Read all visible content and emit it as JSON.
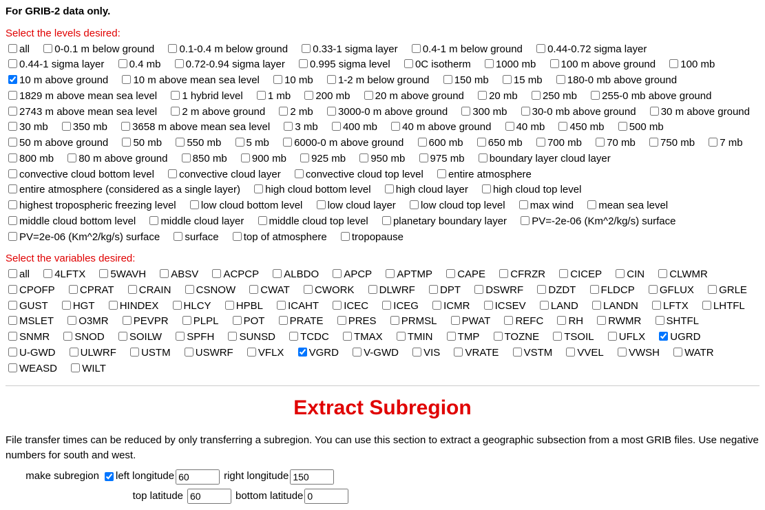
{
  "header": {
    "title": "For GRIB-2 data only."
  },
  "levels": {
    "label": "Select the levels desired:",
    "all": "all",
    "items": [
      {
        "t": "0-0.1 m below ground",
        "c": false
      },
      {
        "t": "0.1-0.4 m below ground",
        "c": false
      },
      {
        "t": "0.33-1 sigma layer",
        "c": false
      },
      {
        "t": "0.4-1 m below ground",
        "c": false
      },
      {
        "t": "0.44-0.72 sigma layer",
        "c": false
      },
      {
        "t": "0.44-1 sigma layer",
        "c": false
      },
      {
        "t": "0.4 mb",
        "c": false
      },
      {
        "t": "0.72-0.94 sigma layer",
        "c": false
      },
      {
        "t": "0.995 sigma level",
        "c": false
      },
      {
        "t": "0C isotherm",
        "c": false
      },
      {
        "t": "1000 mb",
        "c": false
      },
      {
        "t": "100 m above ground",
        "c": false
      },
      {
        "t": "100 mb",
        "c": false
      },
      {
        "t": "10 m above ground",
        "c": true
      },
      {
        "t": "10 m above mean sea level",
        "c": false
      },
      {
        "t": "10 mb",
        "c": false
      },
      {
        "t": "1-2 m below ground",
        "c": false
      },
      {
        "t": "150 mb",
        "c": false
      },
      {
        "t": "15 mb",
        "c": false
      },
      {
        "t": "180-0 mb above ground",
        "c": false
      },
      {
        "t": "1829 m above mean sea level",
        "c": false
      },
      {
        "t": "1 hybrid level",
        "c": false
      },
      {
        "t": "1 mb",
        "c": false
      },
      {
        "t": "200 mb",
        "c": false
      },
      {
        "t": "20 m above ground",
        "c": false
      },
      {
        "t": "20 mb",
        "c": false
      },
      {
        "t": "250 mb",
        "c": false
      },
      {
        "t": "255-0 mb above ground",
        "c": false
      },
      {
        "t": "2743 m above mean sea level",
        "c": false
      },
      {
        "t": "2 m above ground",
        "c": false
      },
      {
        "t": "2 mb",
        "c": false
      },
      {
        "t": "3000-0 m above ground",
        "c": false
      },
      {
        "t": "300 mb",
        "c": false
      },
      {
        "t": "30-0 mb above ground",
        "c": false
      },
      {
        "t": "30 m above ground",
        "c": false
      },
      {
        "t": "30 mb",
        "c": false
      },
      {
        "t": "350 mb",
        "c": false
      },
      {
        "t": "3658 m above mean sea level",
        "c": false
      },
      {
        "t": "3 mb",
        "c": false
      },
      {
        "t": "400 mb",
        "c": false
      },
      {
        "t": "40 m above ground",
        "c": false
      },
      {
        "t": "40 mb",
        "c": false
      },
      {
        "t": "450 mb",
        "c": false
      },
      {
        "t": "500 mb",
        "c": false
      },
      {
        "t": "50 m above ground",
        "c": false
      },
      {
        "t": "50 mb",
        "c": false
      },
      {
        "t": "550 mb",
        "c": false
      },
      {
        "t": "5 mb",
        "c": false
      },
      {
        "t": "6000-0 m above ground",
        "c": false
      },
      {
        "t": "600 mb",
        "c": false
      },
      {
        "t": "650 mb",
        "c": false
      },
      {
        "t": "700 mb",
        "c": false
      },
      {
        "t": "70 mb",
        "c": false
      },
      {
        "t": "750 mb",
        "c": false
      },
      {
        "t": "7 mb",
        "c": false
      },
      {
        "t": "800 mb",
        "c": false
      },
      {
        "t": "80 m above ground",
        "c": false
      },
      {
        "t": "850 mb",
        "c": false
      },
      {
        "t": "900 mb",
        "c": false
      },
      {
        "t": "925 mb",
        "c": false
      },
      {
        "t": "950 mb",
        "c": false
      },
      {
        "t": "975 mb",
        "c": false
      },
      {
        "t": "boundary layer cloud layer",
        "c": false
      },
      {
        "t": "convective cloud bottom level",
        "c": false
      },
      {
        "t": "convective cloud layer",
        "c": false
      },
      {
        "t": "convective cloud top level",
        "c": false
      },
      {
        "t": "entire atmosphere",
        "c": false
      },
      {
        "t": "entire atmosphere (considered as a single layer)",
        "c": false
      },
      {
        "t": "high cloud bottom level",
        "c": false
      },
      {
        "t": "high cloud layer",
        "c": false
      },
      {
        "t": "high cloud top level",
        "c": false
      },
      {
        "t": "highest tropospheric freezing level",
        "c": false
      },
      {
        "t": "low cloud bottom level",
        "c": false
      },
      {
        "t": "low cloud layer",
        "c": false
      },
      {
        "t": "low cloud top level",
        "c": false
      },
      {
        "t": "max wind",
        "c": false
      },
      {
        "t": "mean sea level",
        "c": false
      },
      {
        "t": "middle cloud bottom level",
        "c": false
      },
      {
        "t": "middle cloud layer",
        "c": false
      },
      {
        "t": "middle cloud top level",
        "c": false
      },
      {
        "t": "planetary boundary layer",
        "c": false
      },
      {
        "t": "PV=-2e-06 (Km^2/kg/s) surface",
        "c": false
      },
      {
        "t": "PV=2e-06 (Km^2/kg/s) surface",
        "c": false
      },
      {
        "t": "surface",
        "c": false
      },
      {
        "t": "top of atmosphere",
        "c": false
      },
      {
        "t": "tropopause",
        "c": false
      }
    ]
  },
  "vars": {
    "label": "Select the variables desired:",
    "all": "all",
    "items": [
      {
        "t": "4LFTX",
        "c": false
      },
      {
        "t": "5WAVH",
        "c": false
      },
      {
        "t": "ABSV",
        "c": false
      },
      {
        "t": "ACPCP",
        "c": false
      },
      {
        "t": "ALBDO",
        "c": false
      },
      {
        "t": "APCP",
        "c": false
      },
      {
        "t": "APTMP",
        "c": false
      },
      {
        "t": "CAPE",
        "c": false
      },
      {
        "t": "CFRZR",
        "c": false
      },
      {
        "t": "CICEP",
        "c": false
      },
      {
        "t": "CIN",
        "c": false
      },
      {
        "t": "CLWMR",
        "c": false
      },
      {
        "t": "CPOFP",
        "c": false
      },
      {
        "t": "CPRAT",
        "c": false
      },
      {
        "t": "CRAIN",
        "c": false
      },
      {
        "t": "CSNOW",
        "c": false
      },
      {
        "t": "CWAT",
        "c": false
      },
      {
        "t": "CWORK",
        "c": false
      },
      {
        "t": "DLWRF",
        "c": false
      },
      {
        "t": "DPT",
        "c": false
      },
      {
        "t": "DSWRF",
        "c": false
      },
      {
        "t": "DZDT",
        "c": false
      },
      {
        "t": "FLDCP",
        "c": false
      },
      {
        "t": "GFLUX",
        "c": false
      },
      {
        "t": "GRLE",
        "c": false
      },
      {
        "t": "GUST",
        "c": false
      },
      {
        "t": "HGT",
        "c": false
      },
      {
        "t": "HINDEX",
        "c": false
      },
      {
        "t": "HLCY",
        "c": false
      },
      {
        "t": "HPBL",
        "c": false
      },
      {
        "t": "ICAHT",
        "c": false
      },
      {
        "t": "ICEC",
        "c": false
      },
      {
        "t": "ICEG",
        "c": false
      },
      {
        "t": "ICMR",
        "c": false
      },
      {
        "t": "ICSEV",
        "c": false
      },
      {
        "t": "LAND",
        "c": false
      },
      {
        "t": "LANDN",
        "c": false
      },
      {
        "t": "LFTX",
        "c": false
      },
      {
        "t": "LHTFL",
        "c": false
      },
      {
        "t": "MSLET",
        "c": false
      },
      {
        "t": "O3MR",
        "c": false
      },
      {
        "t": "PEVPR",
        "c": false
      },
      {
        "t": "PLPL",
        "c": false
      },
      {
        "t": "POT",
        "c": false
      },
      {
        "t": "PRATE",
        "c": false
      },
      {
        "t": "PRES",
        "c": false
      },
      {
        "t": "PRMSL",
        "c": false
      },
      {
        "t": "PWAT",
        "c": false
      },
      {
        "t": "REFC",
        "c": false
      },
      {
        "t": "RH",
        "c": false
      },
      {
        "t": "RWMR",
        "c": false
      },
      {
        "t": "SHTFL",
        "c": false
      },
      {
        "t": "SNMR",
        "c": false
      },
      {
        "t": "SNOD",
        "c": false
      },
      {
        "t": "SOILW",
        "c": false
      },
      {
        "t": "SPFH",
        "c": false
      },
      {
        "t": "SUNSD",
        "c": false
      },
      {
        "t": "TCDC",
        "c": false
      },
      {
        "t": "TMAX",
        "c": false
      },
      {
        "t": "TMIN",
        "c": false
      },
      {
        "t": "TMP",
        "c": false
      },
      {
        "t": "TOZNE",
        "c": false
      },
      {
        "t": "TSOIL",
        "c": false
      },
      {
        "t": "UFLX",
        "c": false
      },
      {
        "t": "UGRD",
        "c": true
      },
      {
        "t": "U-GWD",
        "c": false
      },
      {
        "t": "ULWRF",
        "c": false
      },
      {
        "t": "USTM",
        "c": false
      },
      {
        "t": "USWRF",
        "c": false
      },
      {
        "t": "VFLX",
        "c": false
      },
      {
        "t": "VGRD",
        "c": true
      },
      {
        "t": "V-GWD",
        "c": false
      },
      {
        "t": "VIS",
        "c": false
      },
      {
        "t": "VRATE",
        "c": false
      },
      {
        "t": "VSTM",
        "c": false
      },
      {
        "t": "VVEL",
        "c": false
      },
      {
        "t": "VWSH",
        "c": false
      },
      {
        "t": "WATR",
        "c": false
      },
      {
        "t": "WEASD",
        "c": false
      },
      {
        "t": "WILT",
        "c": false
      }
    ]
  },
  "subregion": {
    "heading": "Extract Subregion",
    "desc": "File transfer times can be reduced by only transferring a subregion. You can use this section to extract a geographic subsection from a most GRIB files. Use negative numbers for south and west.",
    "make_label": "make subregion",
    "make_checked": true,
    "leftlon_label": "left longitude",
    "leftlon": "60",
    "rightlon_label": "right longitude",
    "rightlon": "150",
    "toplat_label": "top latitude",
    "toplat": "60",
    "bottomlat_label": "bottom latitude",
    "bottomlat": "0"
  }
}
